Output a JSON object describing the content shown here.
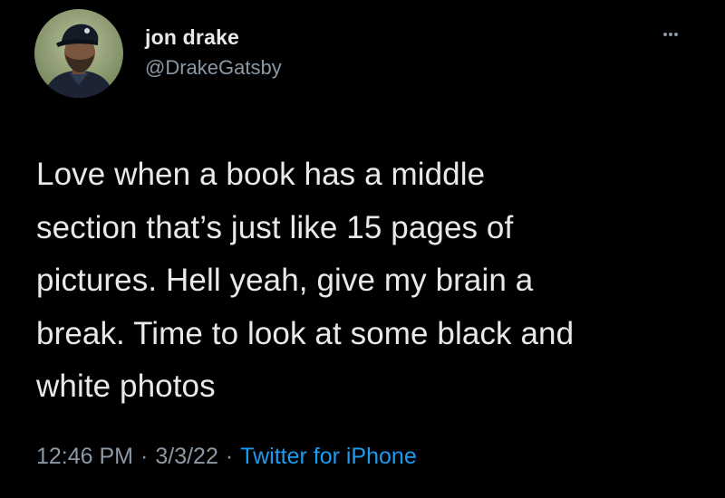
{
  "author": {
    "display_name": "jon drake",
    "handle": "@DrakeGatsby",
    "avatar_icon": "profile-photo"
  },
  "menu": {
    "icon": "more-horizontal-icon"
  },
  "tweet": {
    "text": "Love when a book has a middle\nsection that’s just like 15 pages of\npictures. Hell yeah, give my brain a\nbreak. Time to look at some black and\nwhite photos"
  },
  "meta": {
    "time": "12:46 PM",
    "separator": "·",
    "date": "3/3/22",
    "source": "Twitter for iPhone"
  },
  "colors": {
    "background": "#000000",
    "primary_text": "#e7e9ea",
    "secondary_text": "#8b98a5",
    "accent": "#1d9bf0"
  }
}
